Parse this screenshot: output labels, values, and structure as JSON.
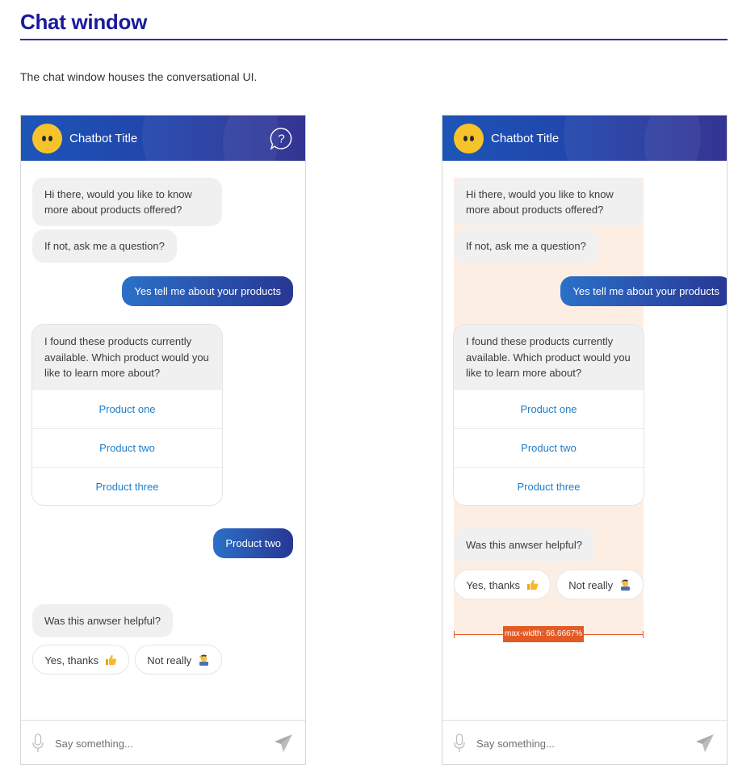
{
  "page": {
    "title": "Chat window",
    "intro": "The chat window houses the conversational UI."
  },
  "chat": {
    "title": "Chatbot Title",
    "greeting": "Hi there, would you like to know more about products offered?",
    "prompt": "If not, ask me a question?",
    "user_reply_1": "Yes tell me about your products",
    "products_intro": "I found these products currently available. Which product would you like to learn more about?",
    "products": [
      "Product one",
      "Product two",
      "Product three"
    ],
    "user_reply_2": "Product two",
    "feedback_question": "Was this anwser helpful?",
    "feedback_yes": "Yes, thanks",
    "feedback_no": "Not really",
    "input_placeholder": "Say something...",
    "annotation": "max-width: 66.6667%"
  },
  "icons": {
    "avatar": "chatbot-avatar-icon",
    "help": "question-bubble-icon",
    "mic": "microphone-icon",
    "send": "paper-plane-icon",
    "thumbs_up": "thumbs-up-emoji",
    "facepalm": "facepalm-emoji"
  },
  "colors": {
    "brand_dark": "#1a1a9e",
    "header_gradient_start": "#1d55b8",
    "header_gradient_end": "#2b2a8e",
    "user_bubble_start": "#2b70c8",
    "user_bubble_end": "#283794",
    "bot_bubble": "#f0f0f0",
    "link": "#1f7dc9",
    "annotation": "#e35a25",
    "annotation_fill": "#fdeee4"
  }
}
